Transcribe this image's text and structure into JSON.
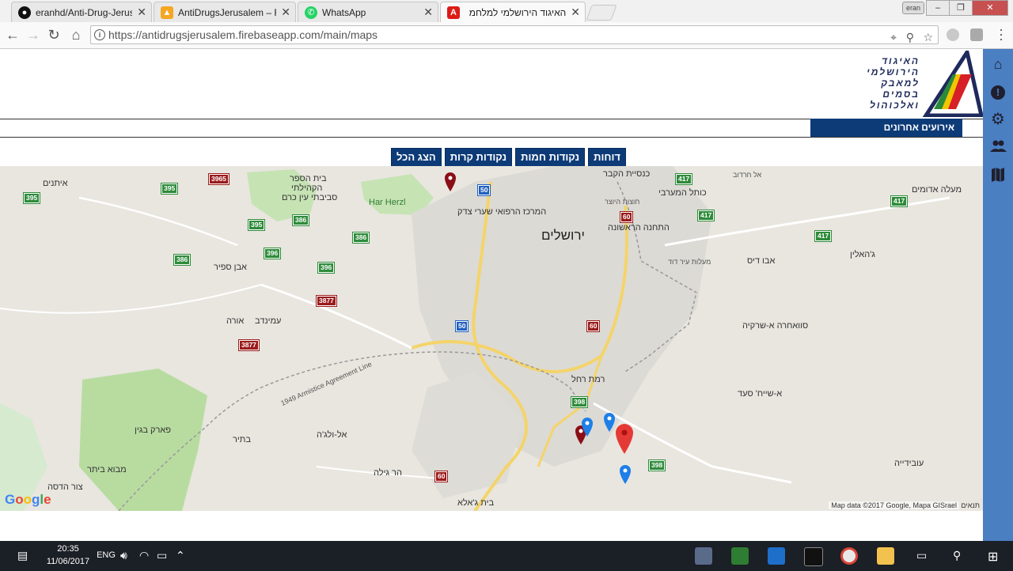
{
  "browser": {
    "tabs": [
      {
        "title": "eranhd/Anti-Drug-Jerusa",
        "favicon": "github-icon",
        "color": "#111111"
      },
      {
        "title": "AntiDrugsJerusalem – Re",
        "favicon": "firebase-icon",
        "color": "#f5a623"
      },
      {
        "title": "WhatsApp",
        "favicon": "whatsapp-icon",
        "color": "#25d366"
      },
      {
        "title": "האיגוד הירושלמי למלחמ",
        "favicon": "angular-icon",
        "color": "#dd1b16"
      }
    ],
    "url": "https://antidrugsjerusalem.firebaseapp.com/main/maps",
    "profile": "eran",
    "window_buttons": [
      "–",
      "❐",
      "✕"
    ]
  },
  "header": {
    "logo_lines": [
      "האיגוד",
      "הירושלמי",
      "למאבק",
      "בסמים",
      "ואלכוהול"
    ],
    "events_tab": "אירועים אחרונים"
  },
  "filters": [
    "הצג הכל",
    "נקודות קרות",
    "נקודות חמות",
    "דוחות"
  ],
  "sidebar": [
    "home-icon",
    "alert-icon",
    "settings-icon",
    "people-icon",
    "map-icon"
  ],
  "map": {
    "labels": {
      "jerusalem": "ירושלים",
      "har_herzl": "Har Herzl",
      "shaare_zedek": "המרכז הרפואי שערי צדק",
      "eitanim": "איתנים",
      "beit_hasefer": "בית הספר",
      "hakehilati": "הקהילתי",
      "svivati": "סביבתי עין כרם",
      "even_sapir": "אבן ספיר",
      "amminadav": "עמינדב",
      "ora": "אורה",
      "park_begin": "פארק בגין",
      "batir": "בתיר",
      "al_walaja": "אל-ולג'ה",
      "har_gilo": "הר גילה",
      "mevo_beitar": "מבוא ביתר",
      "tzur_hadasa": "צור הדסה",
      "beit_jala": "בית ג'אלא",
      "ramat_rachel": "רמת רחל",
      "kneset_hakever": "כנסיית הקבר",
      "kotel": "כותל המערבי",
      "hutzot_hayotzer": "חוצות היוצר",
      "hatahana": "התחנה הראשונה",
      "maale_adumim": "מעלה אדומים",
      "jahalin": "ג'האלין",
      "abu_dis": "אבו דיס",
      "sawahre": "סוואחרה א-שרקיה",
      "sheikh_saad": "א-שייח' סעד",
      "ubeidiya": "עובידייה",
      "armistice": "1949 Armistice Agreement Line",
      "maalot_ir_david": "מעלות עיר דוד",
      "ein_harod": "אל חרדוב"
    },
    "roads": [
      "395",
      "3965",
      "395",
      "386",
      "395",
      "386",
      "396",
      "396",
      "386",
      "3877",
      "3877",
      "50",
      "50",
      "60",
      "60",
      "417",
      "417",
      "417",
      "417",
      "398",
      "398",
      "60"
    ],
    "attribution": "Map data ©2017 Google, Mapa GISrael",
    "terms": "תנאים",
    "google": "Google",
    "pins": [
      {
        "type": "cold",
        "color": "#8b0e16"
      },
      {
        "type": "cold",
        "color": "#8b0e16"
      },
      {
        "type": "hot",
        "color": "#1e7fe8"
      },
      {
        "type": "hot",
        "color": "#1e7fe8"
      },
      {
        "type": "hot",
        "color": "#1e7fe8"
      },
      {
        "type": "report",
        "color": "#e53935"
      }
    ]
  },
  "taskbar": {
    "time": "20:35",
    "date": "11/06/2017",
    "language": "ENG"
  }
}
